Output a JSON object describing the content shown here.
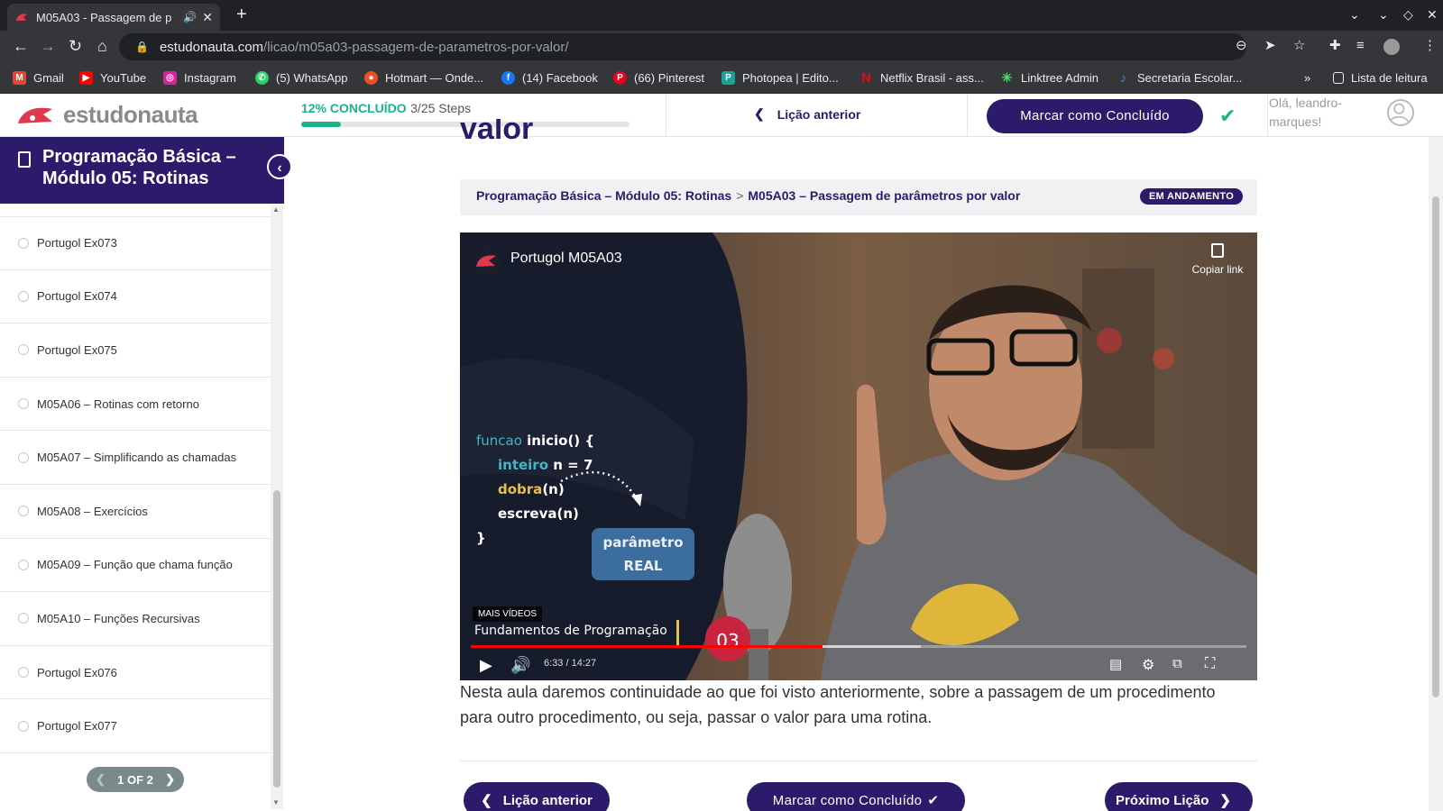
{
  "browser": {
    "tab_title": "M05A03 - Passagem de p",
    "url_domain": "estudonauta.com",
    "url_path": "/licao/m05a03-passagem-de-parametros-por-valor/",
    "bookmarks": [
      {
        "label": "Gmail",
        "icon": "gmail-icon",
        "color": "#ea4335"
      },
      {
        "label": "YouTube",
        "icon": "youtube-icon",
        "color": "#ff0000"
      },
      {
        "label": "Instagram",
        "icon": "instagram-icon",
        "color": "#d6249f"
      },
      {
        "label": "(5) WhatsApp",
        "icon": "whatsapp-icon",
        "color": "#25d366"
      },
      {
        "label": "Hotmart — Onde...",
        "icon": "hotmart-icon",
        "color": "#f04e23"
      },
      {
        "label": "(14) Facebook",
        "icon": "facebook-icon",
        "color": "#1877f2"
      },
      {
        "label": "(66) Pinterest",
        "icon": "pinterest-icon",
        "color": "#e60023"
      },
      {
        "label": "Photopea | Edito...",
        "icon": "photopea-icon",
        "color": "#18a497"
      },
      {
        "label": "Netflix Brasil - ass...",
        "icon": "netflix-icon",
        "color": "#e50914"
      },
      {
        "label": "Linktree Admin",
        "icon": "linktree-icon",
        "color": "#43e660"
      },
      {
        "label": "Secretaria Escolar...",
        "icon": "secretaria-icon",
        "color": "#4a90d9"
      }
    ],
    "reading_list": "Lista de leitura",
    "more_bookmarks": "»"
  },
  "header": {
    "logo_text": "estudonauta",
    "progress_percent_label": "12% CONCLUÍDO",
    "progress_steps": "3/25 Steps",
    "progress_value": 0.12,
    "prev_lesson": "Lição anterior",
    "mark_complete": "Marcar como Concluído",
    "greeting": "Olá, leandro-marques!"
  },
  "sidebar": {
    "course_title": "Programação Básica – Módulo 05: Rotinas",
    "items": [
      {
        "label": "Portugol Ex073"
      },
      {
        "label": "Portugol Ex074"
      },
      {
        "label": "Portugol Ex075"
      },
      {
        "label": "M05A06 – Rotinas com retorno"
      },
      {
        "label": "M05A07 – Simplificando as chamadas"
      },
      {
        "label": "M05A08 – Exercícios"
      },
      {
        "label": "M05A09 – Função que chama função"
      },
      {
        "label": "M05A10 – Funções Recursivas"
      },
      {
        "label": "Portugol Ex076"
      },
      {
        "label": "Portugol Ex077"
      }
    ],
    "pager": "1 OF 2"
  },
  "main": {
    "cut_title": "valor",
    "breadcrumb_course": "Programação Básica – Módulo 05: Rotinas",
    "breadcrumb_sep": ">",
    "breadcrumb_lesson": "M05A03 – Passagem de parâmetros por valor",
    "status_badge": "EM ANDAMENTO",
    "video": {
      "title": "Portugol M05A03",
      "copy_link": "Copiar link",
      "code": [
        "funcao",
        "inicio() {",
        "inteiro",
        "n = 7",
        "dobra",
        "(n)",
        "escreva(n)",
        "}"
      ],
      "param_line1": "parâmetro",
      "param_line2": "REAL",
      "more_videos": "MAIS VÍDEOS",
      "series": "Fundamentos de Programação",
      "episode": "03",
      "time": "6:33 / 14:27",
      "played": 0.453,
      "buffered": 0.58
    },
    "description": "Nesta aula daremos continuidade ao que foi visto anteriormente, sobre a passagem de um procedimento para outro procedimento, ou seja, passar o valor para uma rotina.",
    "footer_prev": "Lição anterior",
    "footer_mark": "Marcar como Concluído",
    "footer_next": "Próximo Lição"
  }
}
